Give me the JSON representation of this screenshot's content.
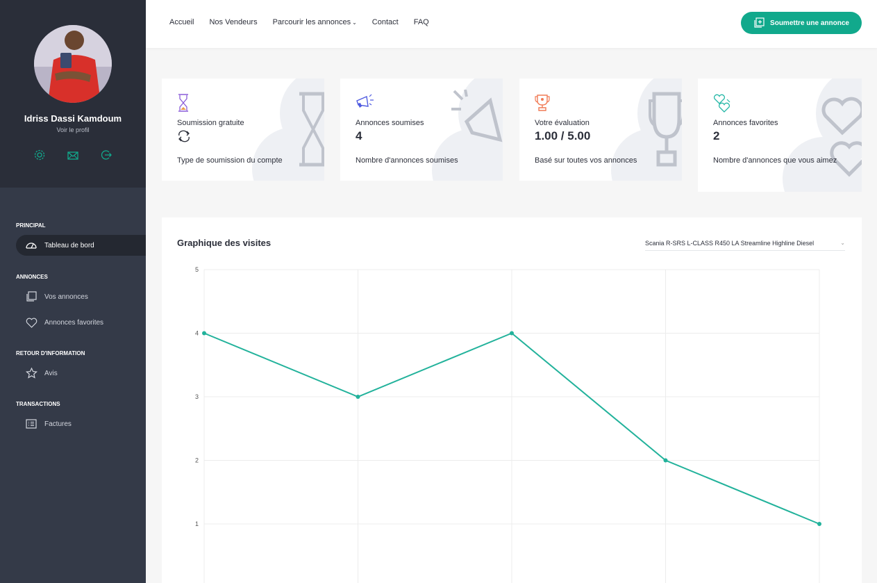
{
  "profile": {
    "name": "Idriss Dassi Kamdoum",
    "link": "Voir le profil"
  },
  "sidebar": {
    "sections": [
      {
        "label": "PRINCIPAL",
        "items": [
          {
            "label": "Tableau de bord",
            "icon": "dashboard-icon",
            "active": true
          }
        ]
      },
      {
        "label": "ANNONCES",
        "items": [
          {
            "label": "Vos annonces",
            "icon": "listings-icon"
          },
          {
            "label": "Annonces favorites",
            "icon": "heart-icon"
          }
        ]
      },
      {
        "label": "RETOUR D'INFORMATION",
        "items": [
          {
            "label": "Avis",
            "icon": "star-icon"
          }
        ]
      },
      {
        "label": "TRANSACTIONS",
        "items": [
          {
            "label": "Factures",
            "icon": "invoice-icon"
          }
        ]
      }
    ]
  },
  "topnav": {
    "items": [
      "Accueil",
      "Nos Vendeurs",
      "Parcourir les annonces",
      "Contact",
      "FAQ"
    ],
    "submit_label": "Soumettre une annonce"
  },
  "cards": [
    {
      "title": "Soumission gratuite",
      "value": "",
      "desc": "Type de soumission du compte",
      "icon": "hourglass-icon"
    },
    {
      "title": "Annonces soumises",
      "value": "4",
      "desc": "Nombre d'annonces soumises",
      "icon": "megaphone-icon"
    },
    {
      "title": "Votre évaluation",
      "value": "1.00 / 5.00",
      "desc": "Basé sur toutes vos annonces",
      "icon": "trophy-icon"
    },
    {
      "title": "Annonces favorites",
      "value": "2",
      "desc": "Nombre d'annonces que vous aimez",
      "icon": "hearts-icon"
    }
  ],
  "chart_panel": {
    "title": "Graphique des visites",
    "selected": "Scania R-SRS L-CLASS R450 LA Streamline Highline Diesel"
  },
  "colors": {
    "accent": "#11a98c",
    "sidebar": "#343a48",
    "sidebar_header": "#2a2e39"
  },
  "chart_data": {
    "type": "line",
    "x": [
      1,
      2,
      3,
      4,
      5
    ],
    "values": [
      4,
      3,
      4,
      2,
      1
    ],
    "y_ticks": [
      "1",
      "2",
      "3",
      "4",
      "5"
    ],
    "ylim": [
      0,
      5
    ],
    "grid": true,
    "color": "#22b29b"
  }
}
